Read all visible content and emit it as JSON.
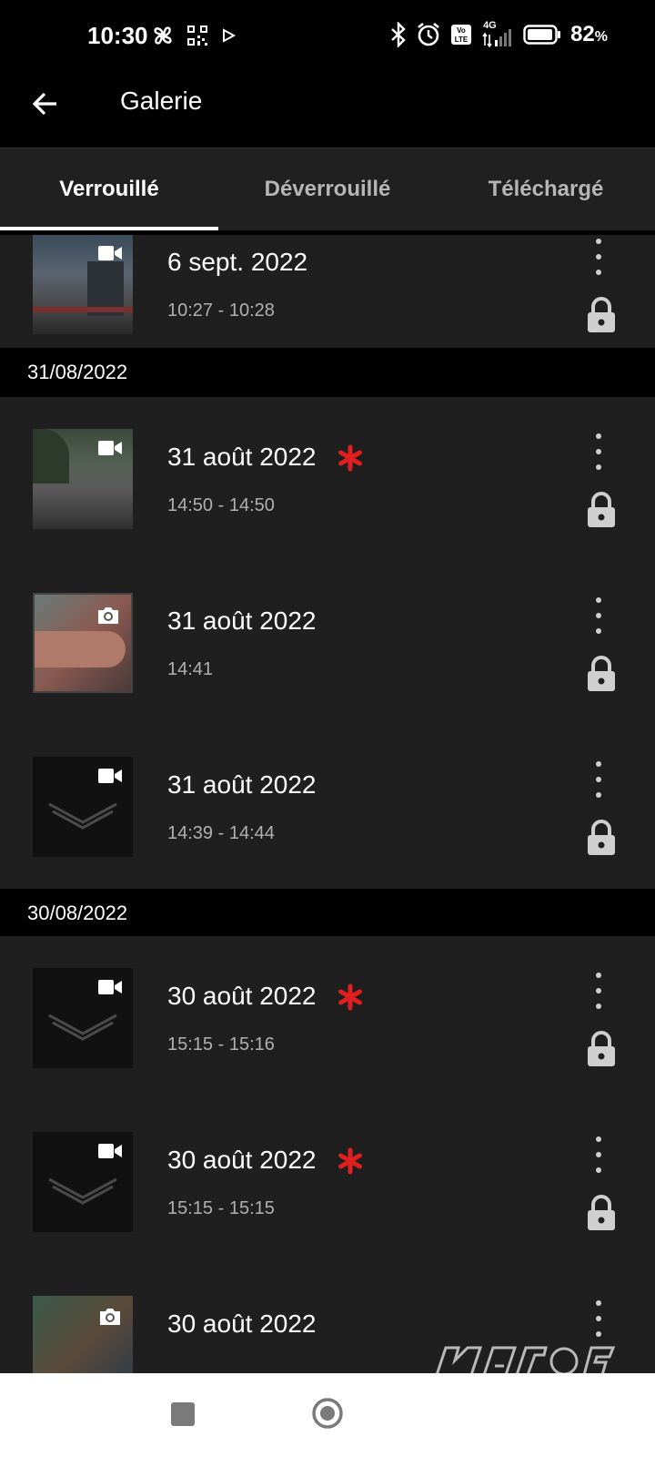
{
  "status_bar": {
    "time": "10:30",
    "battery_percent": "82",
    "battery_unit": "%",
    "network": "4G",
    "icons": [
      "fan-icon",
      "qr-icon",
      "play-icon",
      "bluetooth-icon",
      "alarm-icon",
      "volte-icon",
      "signal-icon",
      "battery-icon"
    ]
  },
  "app_bar": {
    "title": "Galerie",
    "back_icon": "arrow-left-icon"
  },
  "tabs": [
    {
      "label": "Verrouillé",
      "active": true
    },
    {
      "label": "Déverrouillé",
      "active": false
    },
    {
      "label": "Téléchargé",
      "active": false
    }
  ],
  "sections": [
    {
      "date": "",
      "items": [
        {
          "title": "6 sept. 2022",
          "time": "10:27 - 10:28",
          "media": "video",
          "flagged": false
        }
      ]
    },
    {
      "date": "31/08/2022",
      "items": [
        {
          "title": "31 août 2022",
          "time": "14:50 - 14:50",
          "media": "video",
          "flagged": true
        },
        {
          "title": "31 août 2022",
          "time": "14:41",
          "media": "photo",
          "flagged": false
        },
        {
          "title": "31 août 2022",
          "time": "14:39 - 14:44",
          "media": "video",
          "flagged": false
        }
      ]
    },
    {
      "date": "30/08/2022",
      "items": [
        {
          "title": "30 août 2022",
          "time": "15:15 - 15:16",
          "media": "video",
          "flagged": true
        },
        {
          "title": "30 août 2022",
          "time": "15:15 - 15:15",
          "media": "video",
          "flagged": true
        },
        {
          "title": "30 août 2022",
          "time": "",
          "media": "photo",
          "flagged": false
        }
      ]
    }
  ],
  "colors": {
    "flag": "#e02020",
    "row_bg": "#1f1f1f",
    "header_bg": "#000000"
  },
  "watermark": "matos vélo"
}
